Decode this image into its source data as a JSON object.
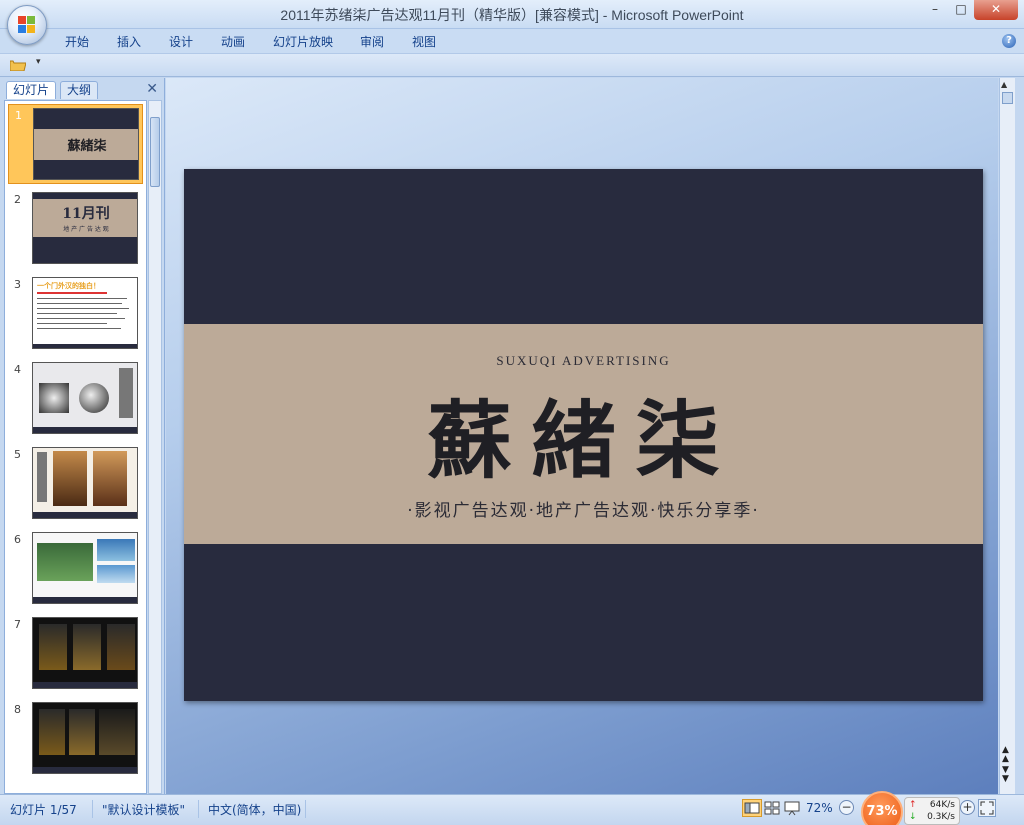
{
  "window": {
    "title": "2011年苏绪柒广告达观11月刊（精华版）[兼容模式] - Microsoft PowerPoint",
    "minimize": "–",
    "maximize": "□",
    "close": "✕"
  },
  "ribbon": {
    "tabs": [
      "开始",
      "插入",
      "设计",
      "动画",
      "幻灯片放映",
      "审阅",
      "视图"
    ],
    "help": "?"
  },
  "qat": {
    "dropdown": "▾"
  },
  "panel": {
    "tab_slides": "幻灯片",
    "tab_outline": "大纲",
    "close": "✕",
    "thumb_numbers": [
      "1",
      "2",
      "3",
      "4",
      "5",
      "6",
      "7",
      "8"
    ],
    "thumb2_title": "11月刊",
    "thumb2_sub": "地 产 广 告 达 观",
    "thumb3_heading": "一个门外汉的独白！",
    "thumb_logo": "蘇緒柒"
  },
  "slide": {
    "english": "SUXUQI  ADVERTISING",
    "chinese": "蘇緒柒",
    "subtitle": "·影视广告达观·地产广告达观·快乐分享季·"
  },
  "status": {
    "slide_info": "幻灯片 1/57",
    "theme": "\"默认设计模板\"",
    "language": "中文(简体，中国)",
    "zoom": "72%",
    "zoom_minus": "−",
    "zoom_plus": "+",
    "speed_percent": "73%",
    "up_speed": "64K/s",
    "down_speed": "0.3K/s",
    "up_arrow": "↑",
    "down_arrow": "↓"
  },
  "colors": {
    "slide_dark": "#282b3e",
    "slide_band": "#bcaa98",
    "selected_thumb": "#ffc65a",
    "ribbon_text": "#15428b"
  }
}
